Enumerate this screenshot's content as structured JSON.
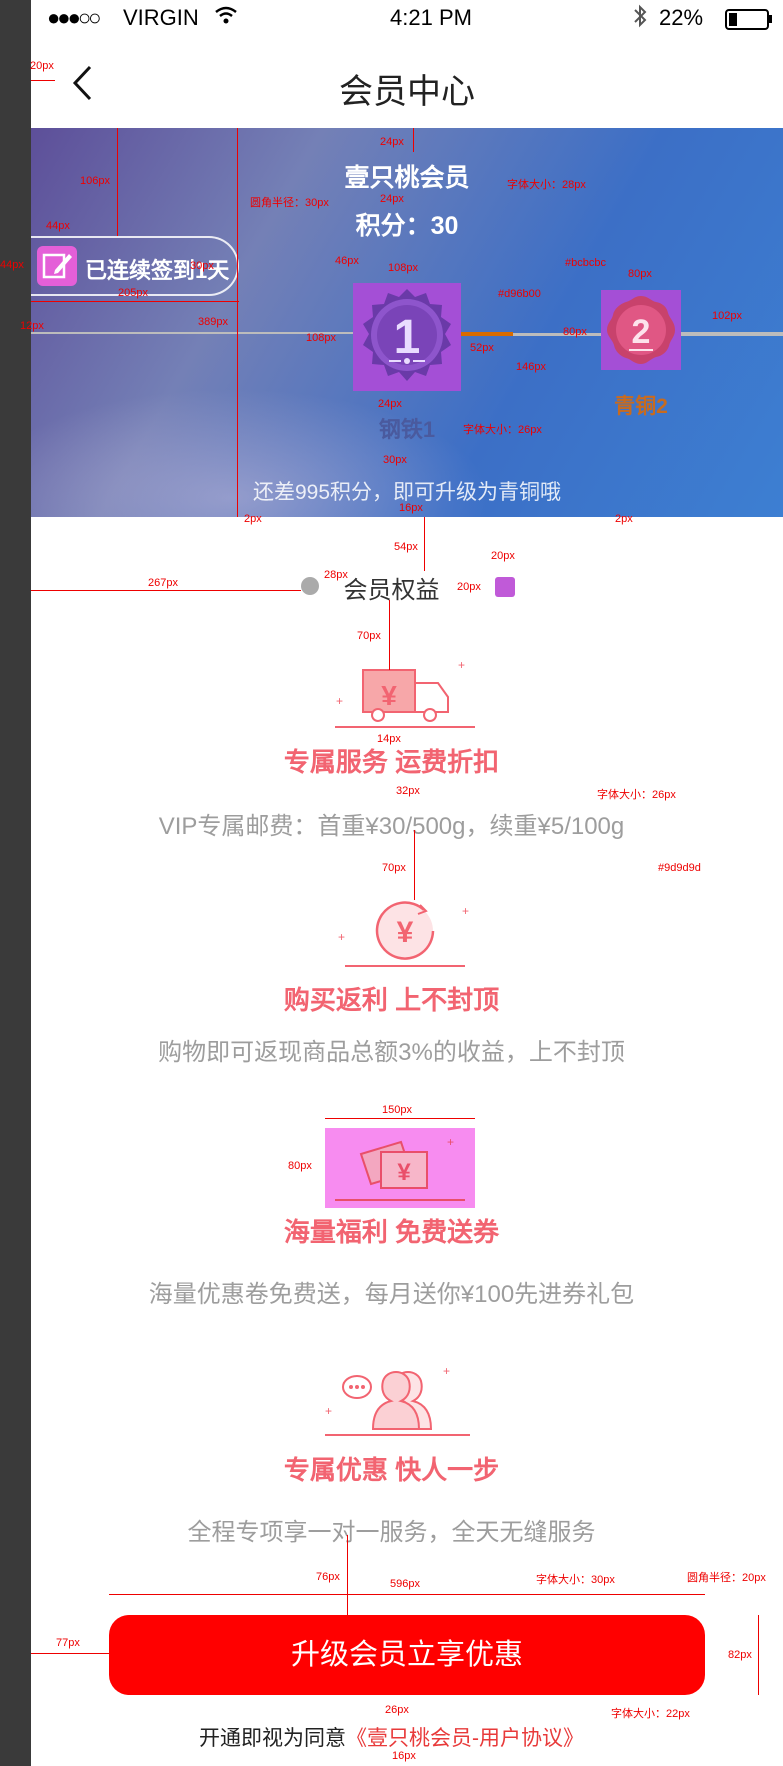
{
  "status_bar": {
    "signal": "●●●○○",
    "carrier": "VIRGIN",
    "time": "4:21 PM",
    "battery": "22%"
  },
  "nav": {
    "title": "会员中心"
  },
  "member": {
    "name": "壹只桃会员",
    "points_line": "积分：30",
    "checkin_label": "已连续签到1天",
    "level_current": "钢铁1",
    "level_next": "青铜2",
    "level_progress_percent": 4,
    "upgrade_tip": "还差995积分，即可升级为青铜哦",
    "colors": {
      "progress": "#d96b00",
      "track": "#bcbcbc"
    }
  },
  "rights": {
    "title": "会员权益",
    "items": [
      {
        "icon": "truck-yen-icon",
        "title": "专属服务 运费折扣",
        "desc": "VIP专属邮费：首重¥30/500g，续重¥5/100g"
      },
      {
        "icon": "yen-cycle-icon",
        "title": "购买返利 上不封顶",
        "desc": "购物即可返现商品总额3%的收益，上不封顶"
      },
      {
        "icon": "coupon-icon",
        "title": "海量福利 免费送券",
        "desc": "海量优惠卷免费送，每月送你¥100先进券礼包"
      },
      {
        "icon": "users-chat-icon",
        "title": "专属优惠 快人一步",
        "desc": "全程专项享一对一服务，全天无缝服务"
      }
    ]
  },
  "cta": {
    "label": "升级会员立享优惠"
  },
  "agreement": {
    "prefix": "开通即视为同意",
    "link": "《壹只桃会员-用户协议》"
  },
  "annotations": {
    "a20": "20px",
    "a24a": "24px",
    "a24b": "24px",
    "a106": "106px",
    "radius30": "圆角半径：30px",
    "font28": "字体大小：28px",
    "a44a": "44px",
    "a44b": "44px",
    "a30inline": "30px",
    "a205": "205px",
    "a12": "12px",
    "a389": "389px",
    "a46": "46px",
    "a108a": "108px",
    "a108b": "108px",
    "cd96b00": "#d96b00",
    "cbcbcbc": "#bcbcbc",
    "a80a": "80px",
    "a80b": "80px",
    "a102": "102px",
    "a52": "52px",
    "a146": "146px",
    "a24c": "24px",
    "font26a": "字体大小：26px",
    "a30b": "30px",
    "a2a": "2px",
    "a2b": "2px",
    "a16": "16px",
    "a54": "54px",
    "a267": "267px",
    "a28": "28px",
    "a20b": "20px",
    "a20c": "20px",
    "a70a": "70px",
    "a14": "14px",
    "a32": "32px",
    "font26b": "字体大小：26px",
    "c9d9d9d": "#9d9d9d",
    "a70b": "70px",
    "a150": "150px",
    "a80c": "80px",
    "a76": "76px",
    "a596": "596px",
    "font30": "字体大小：30px",
    "radius20": "圆角半径：20px",
    "a77": "77px",
    "a82": "82px",
    "a26": "26px",
    "font22": "字体大小：22px",
    "a16b": "16px"
  }
}
